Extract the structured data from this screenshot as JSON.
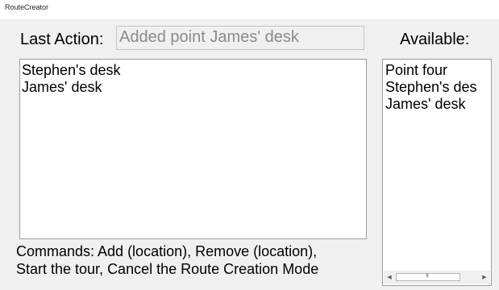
{
  "window": {
    "title": "RouteCreator"
  },
  "last_action": {
    "label": "Last Action:",
    "value": "Added point James' desk"
  },
  "route_list": {
    "items": [
      "Stephen's desk",
      "James' desk"
    ]
  },
  "available": {
    "label": "Available:",
    "items": [
      "Point four",
      "Stephen's des",
      "James' desk"
    ],
    "scroll_grip": "III"
  },
  "commands": {
    "line1": "Commands: Add (location), Remove (location),",
    "line2": "Start the tour, Cancel the Route Creation Mode"
  }
}
